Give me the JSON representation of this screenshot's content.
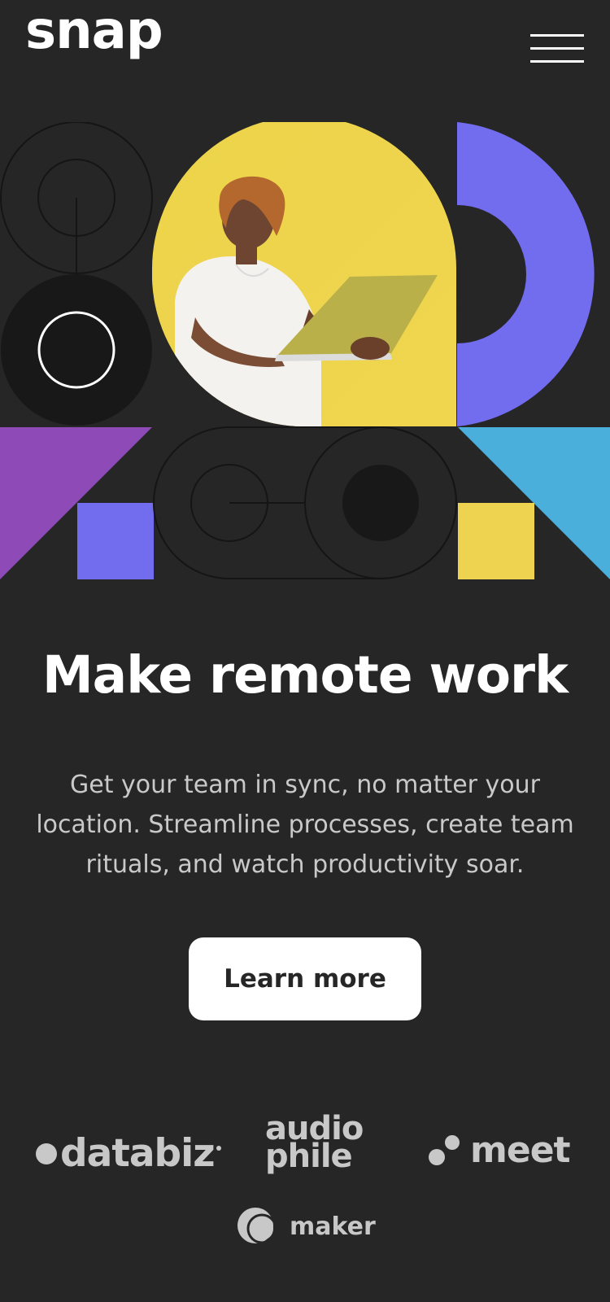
{
  "header": {
    "logo": "snap",
    "menu_icon": "hamburger-menu-icon"
  },
  "hero": {
    "image_alt": "Man holding a laptop against a yellow background",
    "title": "Make remote work",
    "description": "Get your team in sync, no matter your location. Streamline processes, create team rituals, and watch productivity soar.",
    "cta_label": "Learn more"
  },
  "clients": {
    "databiz": "databiz",
    "audiophile_top": "audio",
    "audiophile_bottom": "phile",
    "meet": "meet",
    "maker": "maker"
  },
  "colors": {
    "background": "#262626",
    "purple": "#8e4bb8",
    "indigo": "#726cef",
    "yellow": "#eed350",
    "sky_blue": "#4aafdb",
    "dark_circle": "#1a1a1a",
    "button_bg": "#ffffff"
  }
}
